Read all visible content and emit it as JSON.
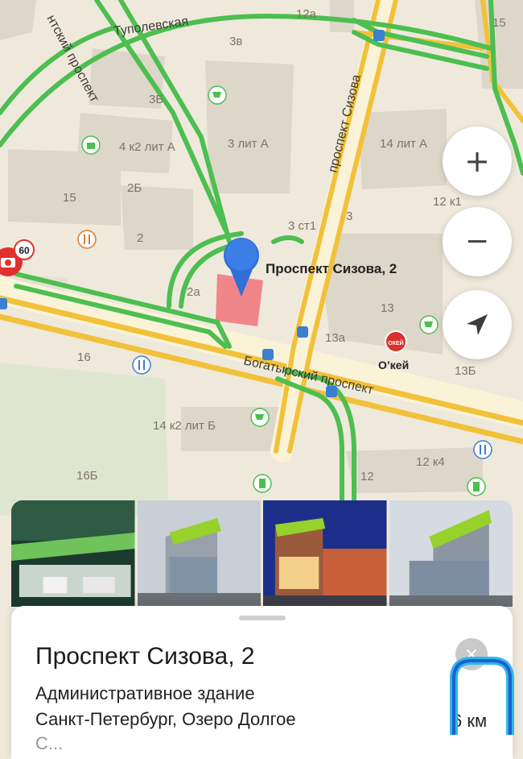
{
  "map": {
    "streets": {
      "tupolevskaya": "Туполевская",
      "entuziastov": "нтский проспект",
      "sizova": "проспект Сизова",
      "bogatyrsky": "Богатырский проспект"
    },
    "buildings": [
      "12а",
      "3в",
      "3Б",
      "3 лит А",
      "4 к2 лит А",
      "2Б",
      "15",
      "2",
      "3 ст1",
      "3",
      "14 лит А",
      "12 к1",
      "15",
      "2а",
      "13",
      "13а",
      "13Б",
      "16",
      "14 к2 лит Б",
      "16Б",
      "12",
      "12 к4"
    ],
    "pin_label": "Проспект Сизова, 2",
    "okey_label": "О’кей",
    "okey_badge": "ОКЕЙ",
    "camera_speed": "60"
  },
  "controls": {
    "zoom_in_label": "+",
    "zoom_out_label": "−"
  },
  "place_card": {
    "title": "Проспект Сизова, 2",
    "type": "Административное здание",
    "address": "Санкт-Петербург, Озеро Долгое",
    "more_text": "С...",
    "distance": "6 км",
    "close_label": "×"
  },
  "colors": {
    "map_bg": "#efe9dc",
    "road_yellow": "#f2c13a",
    "road_green": "#4cbf50",
    "pin_blue": "#2f6fd6",
    "building": "#dcd6c8",
    "selected_building": "#f0868a",
    "okey_red": "#d9312b"
  },
  "icons": [
    "plus-icon",
    "minus-icon",
    "navigation-arrow-icon",
    "close-icon",
    "speed-camera-icon",
    "shopping-cart-icon",
    "bus-stop-icon",
    "fuel-icon",
    "food-icon",
    "bag-icon"
  ]
}
